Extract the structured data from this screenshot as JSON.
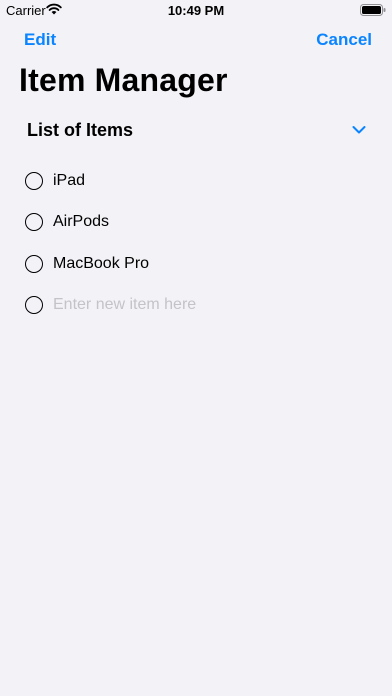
{
  "status_bar": {
    "carrier": "Carrier",
    "time": "10:49 PM"
  },
  "nav": {
    "left_label": "Edit",
    "right_label": "Cancel"
  },
  "title": "Item Manager",
  "section": {
    "title": "List of Items",
    "items": [
      "iPad",
      "AirPods",
      "MacBook Pro"
    ],
    "new_item_placeholder": "Enter new item here"
  },
  "colors": {
    "accent": "#0a84ff",
    "background": "#f2f2f7",
    "placeholder": "#c4c4c8"
  },
  "icons": [
    "wifi-icon",
    "battery-icon",
    "chevron-down-icon",
    "radio-circle-icon"
  ]
}
